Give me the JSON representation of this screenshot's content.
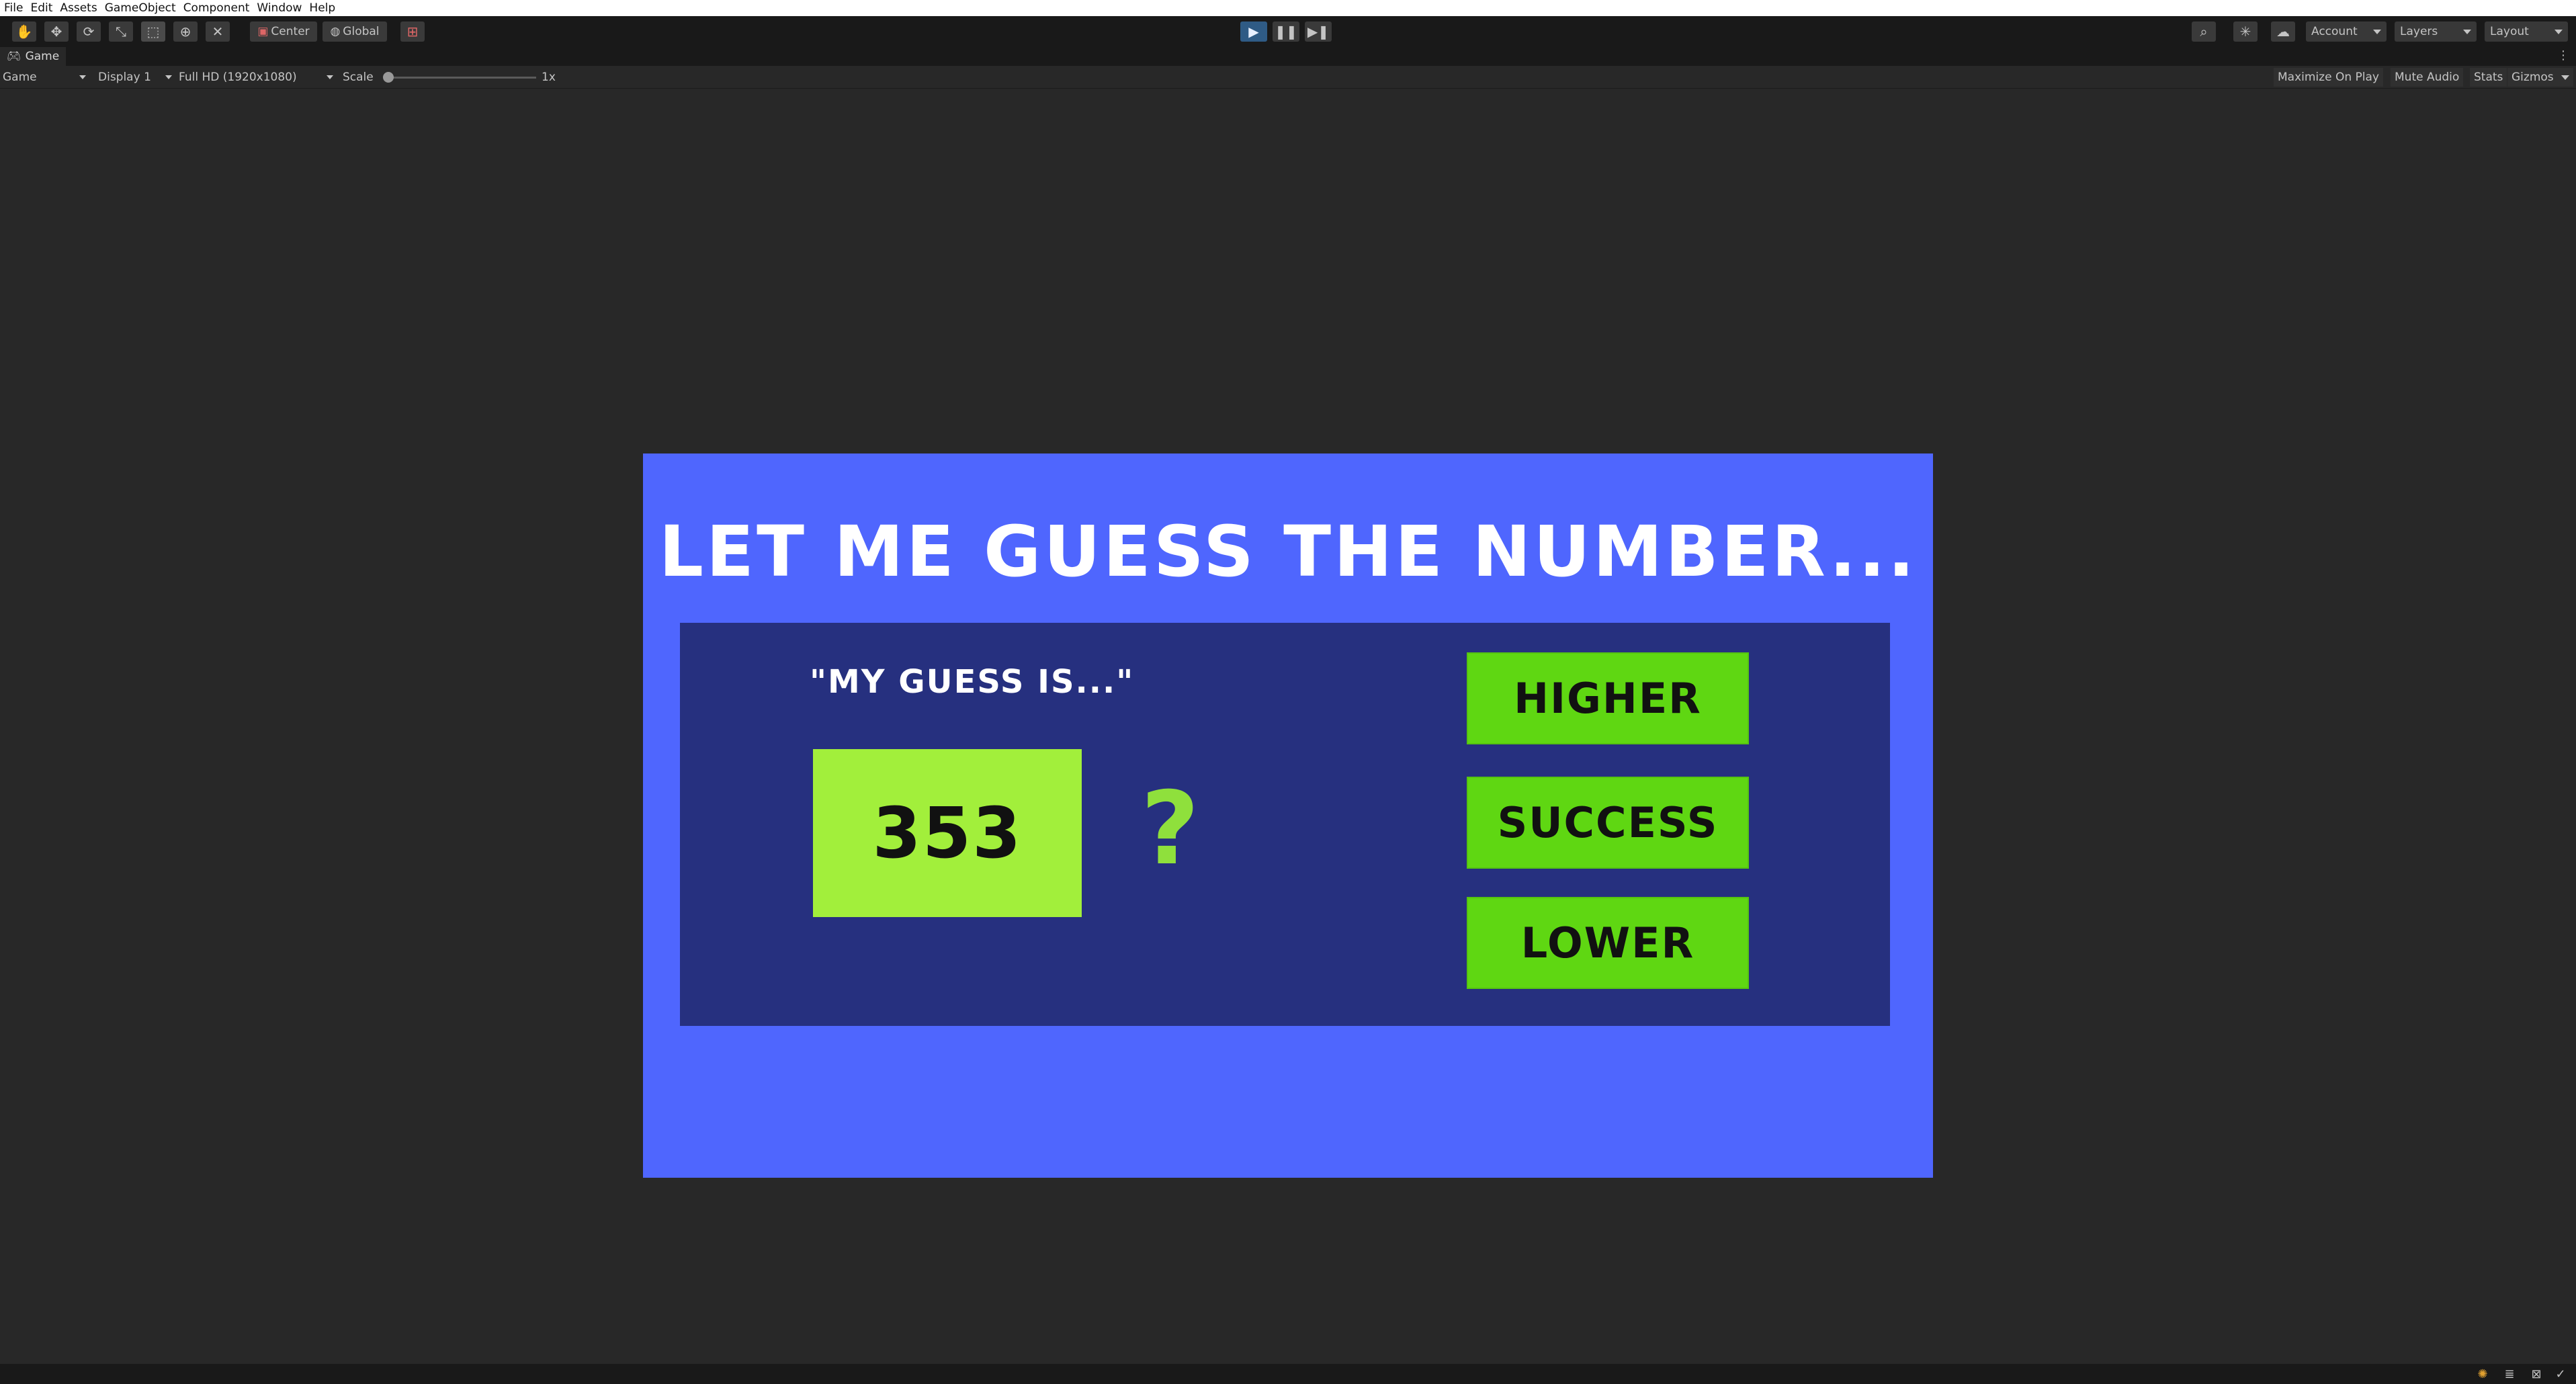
{
  "menu": [
    "File",
    "Edit",
    "Assets",
    "GameObject",
    "Component",
    "Window",
    "Help"
  ],
  "toolbar": {
    "pivot_mode": "Center",
    "pivot_rotation": "Global",
    "account_label": "Account",
    "layers_label": "Layers",
    "layout_label": "Layout"
  },
  "game_view": {
    "tab_label": "Game",
    "view_select": "Game",
    "display_select": "Display 1",
    "resolution_select": "Full HD (1920x1080)",
    "scale_label": "Scale",
    "scale_value": "1x",
    "maximize_label": "Maximize On Play",
    "mute_label": "Mute Audio",
    "stats_label": "Stats",
    "gizmos_label": "Gizmos"
  },
  "game": {
    "title": "LET ME GUESS THE NUMBER...",
    "guess_label": "\"MY GUESS IS...\"",
    "guess_value": "353",
    "question_mark": "?",
    "buttons": {
      "higher": "HIGHER",
      "success": "SUCCESS",
      "lower": "LOWER"
    },
    "colors": {
      "background": "#4f66fe",
      "panel": "#26307f",
      "guess_box": "#a2ef3b",
      "button": "#5fd712"
    }
  }
}
